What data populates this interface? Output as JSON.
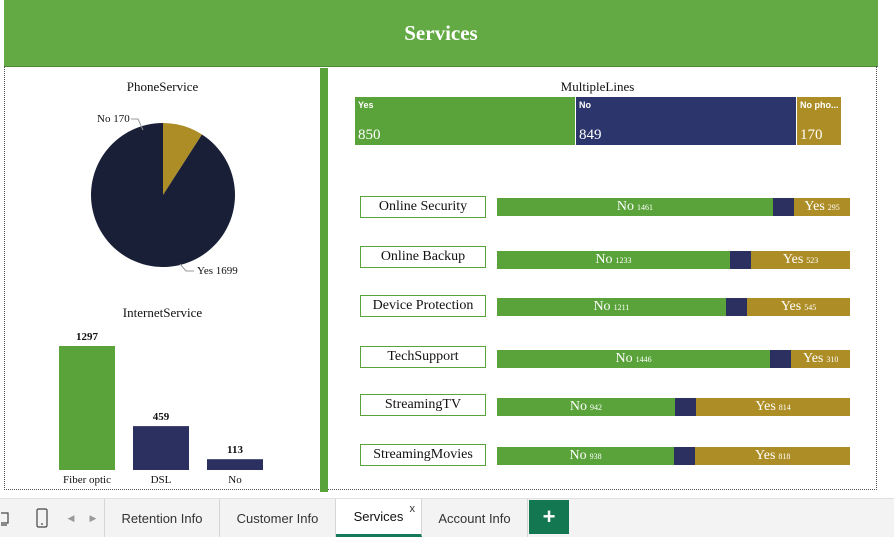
{
  "header": {
    "title": "Services"
  },
  "phone_service": {
    "title": "PhoneService",
    "slices": [
      {
        "label": "No",
        "value": 170,
        "display": "No 170",
        "color": "#ad8d25"
      },
      {
        "label": "Yes",
        "value": 1699,
        "display": "Yes 1699",
        "color": "#1a1f38"
      }
    ]
  },
  "internet_service": {
    "title": "InternetService",
    "bars": [
      {
        "category": "Fiber optic",
        "value": 1297,
        "color": "#5aa33a"
      },
      {
        "category": "DSL",
        "value": 459,
        "color": "#2b3060"
      },
      {
        "category": "No",
        "value": 113,
        "color": "#2b3060"
      }
    ]
  },
  "multiple_lines": {
    "title": "MultipleLines",
    "blocks": [
      {
        "label": "Yes",
        "value": "850",
        "color": "#5aa33a"
      },
      {
        "label": "No",
        "value": "849",
        "color": "#2d366c"
      },
      {
        "label": "No pho...",
        "value": "170",
        "color": "#ad8d25"
      }
    ]
  },
  "services": [
    {
      "name": "Online Security",
      "no_label": "No",
      "no": 1461,
      "yes_label": "Yes",
      "yes": 295,
      "mid": 113
    },
    {
      "name": "Online Backup",
      "no_label": "No",
      "no": 1233,
      "yes_label": "Yes",
      "yes": 523,
      "mid": 113
    },
    {
      "name": "Device Protection",
      "no_label": "No",
      "no": 1211,
      "yes_label": "Yes",
      "yes": 545,
      "mid": 113
    },
    {
      "name": "TechSupport",
      "no_label": "No",
      "no": 1446,
      "yes_label": "Yes",
      "yes": 310,
      "mid": 113
    },
    {
      "name": "StreamingTV",
      "no_label": "No",
      "no": 942,
      "yes_label": "Yes",
      "yes": 814,
      "mid": 113
    },
    {
      "name": "StreamingMovies",
      "no_label": "No",
      "no": 938,
      "yes_label": "Yes",
      "yes": 818,
      "mid": 113
    }
  ],
  "colors": {
    "green": "#5aa33a",
    "navy": "#2b3060",
    "gold": "#ad8d25"
  },
  "tabs": [
    {
      "label": "Retention Info",
      "active": false
    },
    {
      "label": "Customer Info",
      "active": false
    },
    {
      "label": "Services",
      "active": true,
      "close": "x"
    },
    {
      "label": "Account Info",
      "active": false
    }
  ],
  "tabbar": {
    "add_label": "+"
  },
  "chart_data": [
    {
      "type": "pie",
      "title": "PhoneService",
      "categories": [
        "No",
        "Yes"
      ],
      "values": [
        170,
        1699
      ]
    },
    {
      "type": "bar",
      "title": "InternetService",
      "categories": [
        "Fiber optic",
        "DSL",
        "No"
      ],
      "values": [
        1297,
        459,
        113
      ]
    },
    {
      "type": "bar",
      "title": "MultipleLines",
      "categories": [
        "Yes",
        "No",
        "No pho..."
      ],
      "values": [
        850,
        849,
        170
      ]
    }
  ]
}
